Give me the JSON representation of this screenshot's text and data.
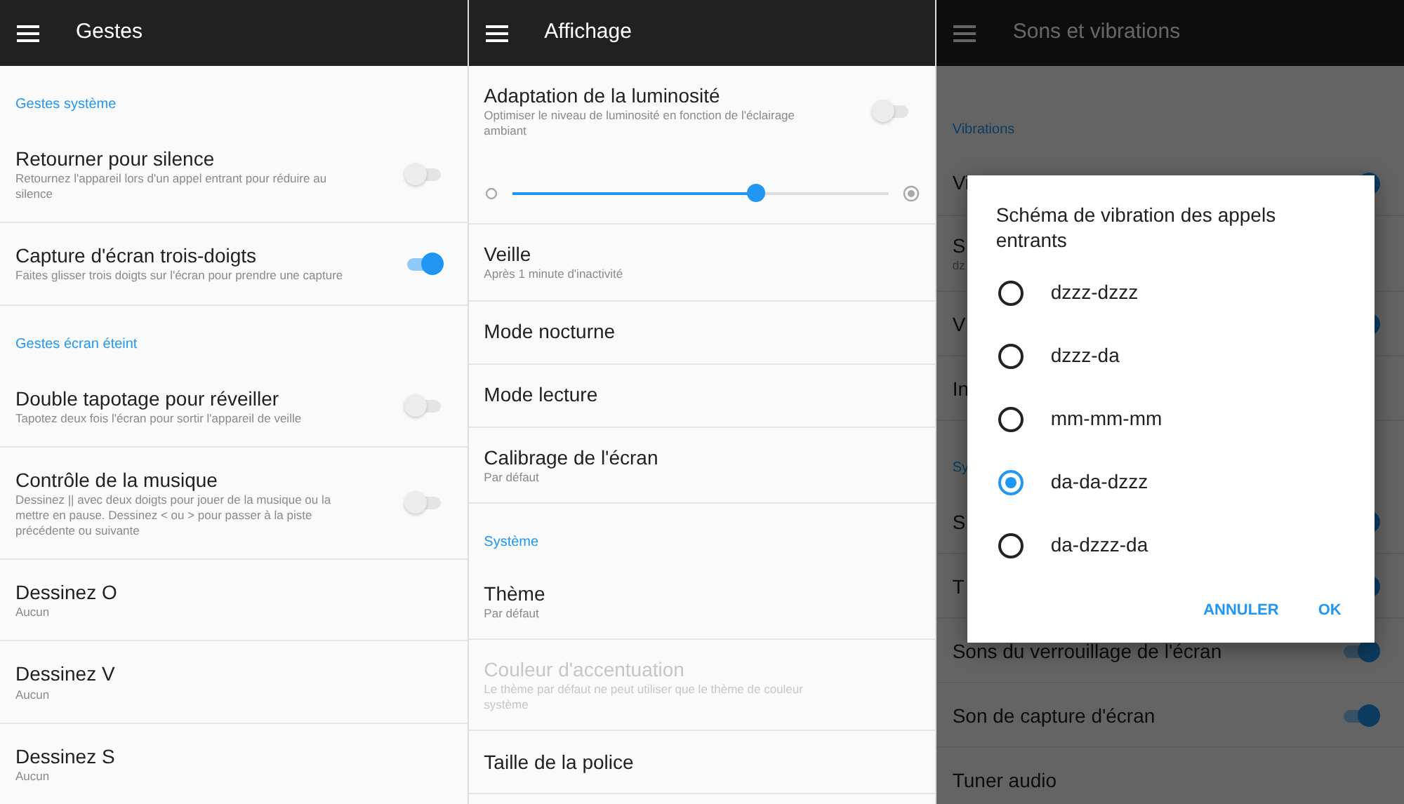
{
  "screens": [
    {
      "title": "Gestes",
      "dimmed": false,
      "items": [
        {
          "kind": "header",
          "title": "Gestes système"
        },
        {
          "kind": "setting",
          "title": "Retourner pour silence",
          "subtitle": "Retournez l'appareil lors d'un appel entrant pour réduire au silence",
          "on": false
        },
        {
          "kind": "setting",
          "title": "Capture d'écran trois-doigts",
          "subtitle": "Faites glisser trois doigts sur l'écran pour prendre une capture",
          "on": true
        },
        {
          "kind": "header",
          "title": "Gestes écran éteint"
        },
        {
          "kind": "setting",
          "title": "Double tapotage pour réveiller",
          "subtitle": "Tapotez deux fois l'écran pour sortir l'appareil de veille",
          "on": false
        },
        {
          "kind": "setting",
          "title": "Contrôle de la musique",
          "subtitle": "Dessinez || avec deux doigts pour jouer de la musique ou la mettre en pause. Dessinez < ou > pour passer à la piste précédente ou suivante",
          "on": false
        },
        {
          "kind": "setting",
          "title": "Dessinez O",
          "subtitle": "Aucun"
        },
        {
          "kind": "setting",
          "title": "Dessinez V",
          "subtitle": "Aucun"
        },
        {
          "kind": "setting",
          "title": "Dessinez S",
          "subtitle": "Aucun"
        }
      ]
    },
    {
      "title": "Affichage",
      "dimmed": false,
      "items": [
        {
          "kind": "setting",
          "title": "Adaptation de la luminosité",
          "subtitle": "Optimiser le niveau de luminosité en fonction de l'éclairage ambiant",
          "on": false,
          "slider": {
            "level": 0.645
          }
        },
        {
          "kind": "setting",
          "title": "Veille",
          "subtitle": "Après 1 minute d'inactivité"
        },
        {
          "kind": "setting",
          "title": "Mode nocturne"
        },
        {
          "kind": "setting",
          "title": "Mode lecture"
        },
        {
          "kind": "setting",
          "title": "Calibrage de l'écran",
          "subtitle": "Par défaut"
        },
        {
          "kind": "header",
          "title": "Système"
        },
        {
          "kind": "setting",
          "title": "Thème",
          "subtitle": "Par défaut"
        },
        {
          "kind": "setting",
          "title": "Couleur d'accentuation",
          "subtitle": "Le thème par défaut ne peut utiliser que le thème de couleur système",
          "disabled": true
        },
        {
          "kind": "setting",
          "title": "Taille de la police"
        }
      ]
    },
    {
      "title": "Sons et vibrations",
      "dimmed": true,
      "items": [
        {
          "kind": "header",
          "title": "Vibrations"
        },
        {
          "kind": "setting",
          "title": "Vi",
          "on": true
        },
        {
          "kind": "setting",
          "title": "S",
          "subtitle": "dz"
        },
        {
          "kind": "setting",
          "title": "V",
          "on": true
        },
        {
          "kind": "setting",
          "title": "In"
        },
        {
          "kind": "header",
          "title": "Sy"
        },
        {
          "kind": "setting",
          "title": "S",
          "on": true
        },
        {
          "kind": "setting",
          "title": "T",
          "on": true
        },
        {
          "kind": "setting",
          "title": "Sons du verrouillage de l'écran",
          "on": true
        },
        {
          "kind": "setting",
          "title": "Son de capture d'écran",
          "on": true
        },
        {
          "kind": "setting",
          "title": "Tuner audio"
        }
      ]
    }
  ],
  "dialog": {
    "title": "Schéma de vibration des appels entrants",
    "options": [
      {
        "label": "dzzz-dzzz",
        "selected": false
      },
      {
        "label": "dzzz-da",
        "selected": false
      },
      {
        "label": "mm-mm-mm",
        "selected": false
      },
      {
        "label": "da-da-dzzz",
        "selected": true
      },
      {
        "label": "da-dzzz-da",
        "selected": false
      }
    ],
    "buttons": [
      "ANNULER",
      "OK"
    ]
  }
}
